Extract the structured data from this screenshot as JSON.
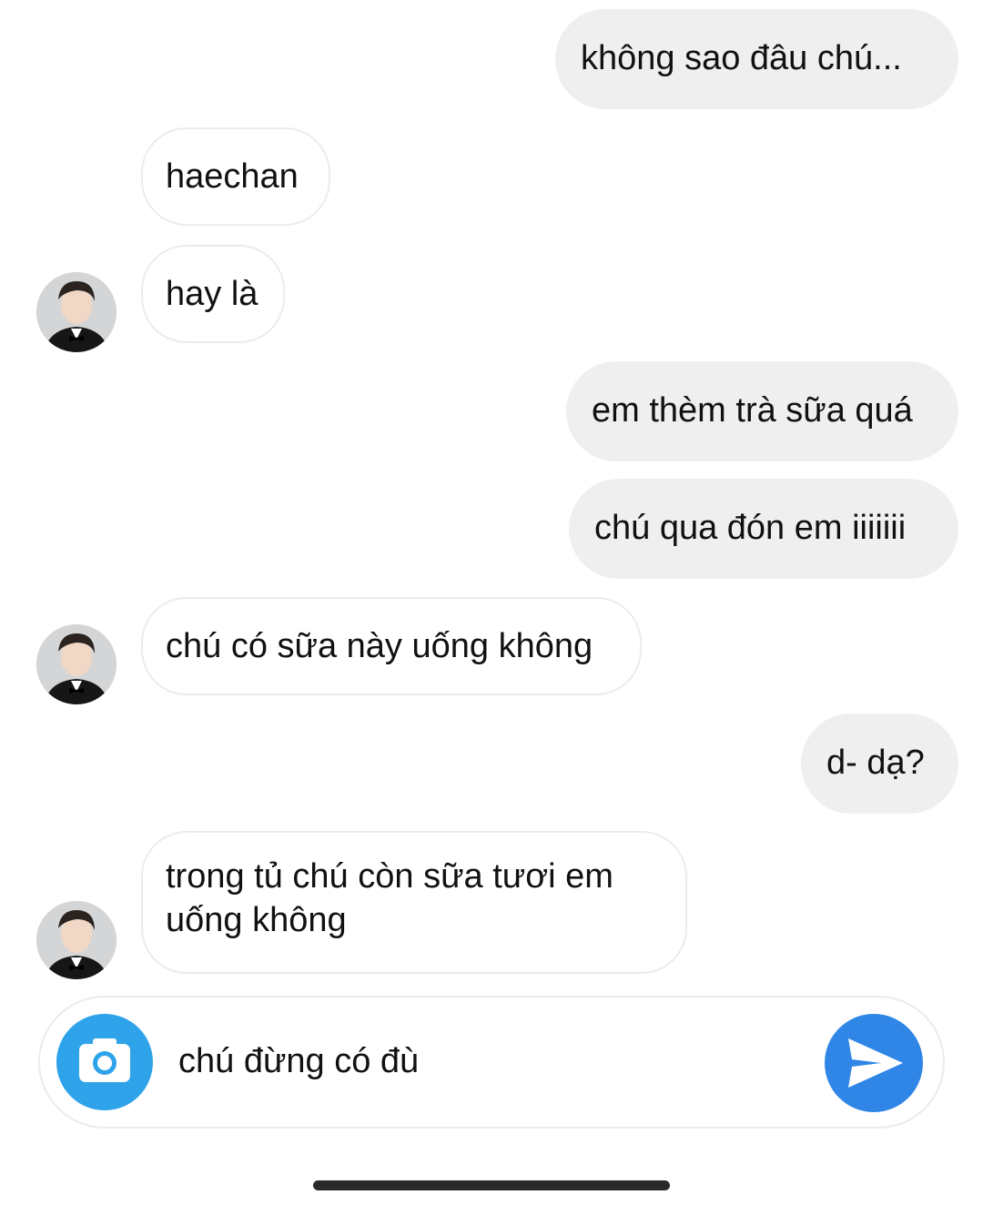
{
  "messages": [
    {
      "text": "không sao đâu chú..."
    },
    {
      "text": "haechan"
    },
    {
      "text": "hay là"
    },
    {
      "text": "em thèm trà sữa quá"
    },
    {
      "text": "chú qua đón em iiiiiii"
    },
    {
      "text": "chú có sữa này uống không"
    },
    {
      "text": "d- dạ?"
    },
    {
      "text": "trong tủ chú còn sữa tươi em uống không"
    }
  ],
  "composer": {
    "text": "chú đừng có đù",
    "camera_icon": "camera-icon",
    "send_icon": "send-icon"
  },
  "colors": {
    "outgoing_bubble": "#efefef",
    "incoming_border": "#ececec",
    "camera_button": "#2ea3ea",
    "send_button": "#2f86e6"
  }
}
